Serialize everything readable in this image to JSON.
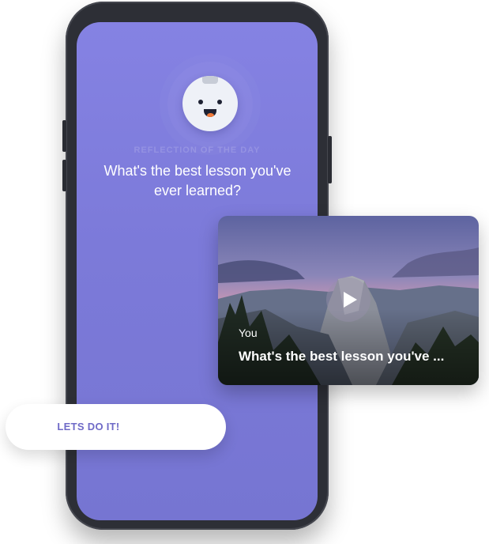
{
  "mascot": {
    "icon": "smiling-robot-icon"
  },
  "reflection": {
    "overline": "REFLECTION OF THE DAY",
    "question": "What's the best lesson you've ever learned?"
  },
  "video_card": {
    "author": "You",
    "title": "What's the best lesson you've ...",
    "play_icon": "play-icon"
  },
  "cta": {
    "label": "LETS DO IT!"
  },
  "colors": {
    "screen": "#8582e3",
    "phone": "#2d2f36",
    "cta_text": "#6f6ac7"
  }
}
